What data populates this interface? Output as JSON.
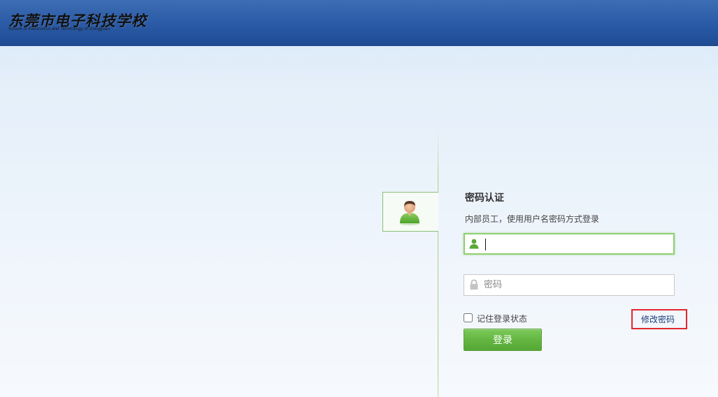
{
  "header": {
    "logo_title": "东莞市电子科技学校",
    "logo_subtitle": "School of Electronics and Technology of Dongguan"
  },
  "login": {
    "title": "密码认证",
    "subtitle": "内部员工，使用用户名密码方式登录",
    "username_value": "",
    "password_placeholder": "密码",
    "remember_label": "记住登录状态",
    "remember_checked": false,
    "change_password_label": "修改密码",
    "submit_label": "登录"
  },
  "icons": {
    "avatar": "user-avatar-icon",
    "username": "user-icon",
    "password": "lock-icon"
  },
  "colors": {
    "header": "#2a5aa6",
    "accent_green": "#62b540",
    "highlight_red": "#e2262f",
    "link": "#1b3e7a"
  }
}
